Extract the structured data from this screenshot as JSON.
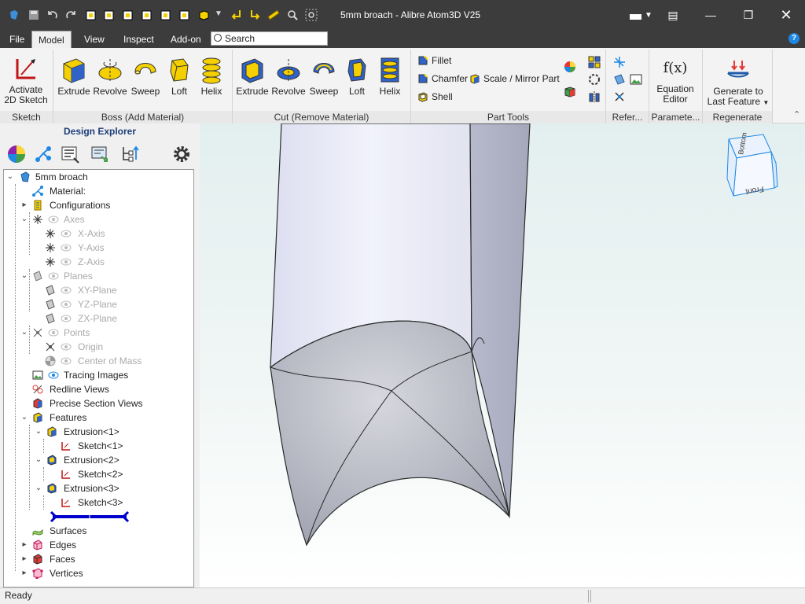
{
  "window": {
    "title": "5mm broach - Alibre Atom3D V25",
    "controls": [
      "minimize",
      "restore",
      "close"
    ]
  },
  "menu": {
    "tabs": [
      "File",
      "Model",
      "View",
      "Inspect",
      "Add-on"
    ],
    "active_tab": "Model",
    "search_placeholder": "Search"
  },
  "ribbon": {
    "sketch": {
      "button_line1": "Activate",
      "button_line2": "2D Sketch",
      "group_label": "Sketch"
    },
    "boss": {
      "buttons": [
        "Extrude",
        "Revolve",
        "Sweep",
        "Loft",
        "Helix"
      ],
      "group_label": "Boss (Add Material)"
    },
    "cut": {
      "buttons": [
        "Extrude",
        "Revolve",
        "Sweep",
        "Loft",
        "Helix"
      ],
      "group_label": "Cut (Remove Material)"
    },
    "part_tools": {
      "fillet": "Fillet",
      "chamfer": "Chamfer",
      "scale_mirror": "Scale / Mirror Part",
      "shell": "Shell",
      "group_label": "Part Tools"
    },
    "reference": {
      "group_label": "Refer..."
    },
    "parameters": {
      "button_line1": "Equation",
      "button_line2": "Editor",
      "icon_text": "f(x)",
      "group_label": "Paramete..."
    },
    "regenerate": {
      "button_line1": "Generate to",
      "button_line2": "Last Feature",
      "group_label": "Regenerate"
    }
  },
  "design_explorer": {
    "title": "Design Explorer",
    "tree": {
      "root": "5mm broach",
      "material": "Material:",
      "configurations": "Configurations",
      "axes": "Axes",
      "x_axis": "X-Axis",
      "y_axis": "Y-Axis",
      "z_axis": "Z-Axis",
      "planes": "Planes",
      "xy_plane": "XY-Plane",
      "yz_plane": "YZ-Plane",
      "zx_plane": "ZX-Plane",
      "points": "Points",
      "origin": "Origin",
      "center_of_mass": "Center of Mass",
      "tracing_images": "Tracing Images",
      "redline_views": "Redline Views",
      "precise_section_views": "Precise Section Views",
      "features": "Features",
      "extrusion1": "Extrusion<1>",
      "sketch1": "Sketch<1>",
      "extrusion2": "Extrusion<2>",
      "sketch2": "Sketch<2>",
      "extrusion3": "Extrusion<3>",
      "sketch3": "Sketch<3>",
      "surfaces": "Surfaces",
      "edges": "Edges",
      "faces": "Faces",
      "vertices": "Vertices"
    }
  },
  "viewcube": {
    "top_face": "Bottom",
    "front_face": "Front"
  },
  "status": {
    "text": "Ready"
  },
  "colors": {
    "titlebar": "#3c3c3c",
    "ribbon": "#f3f3f3",
    "accent": "#1a5fb4",
    "rollback_bar": "#0000cc"
  }
}
